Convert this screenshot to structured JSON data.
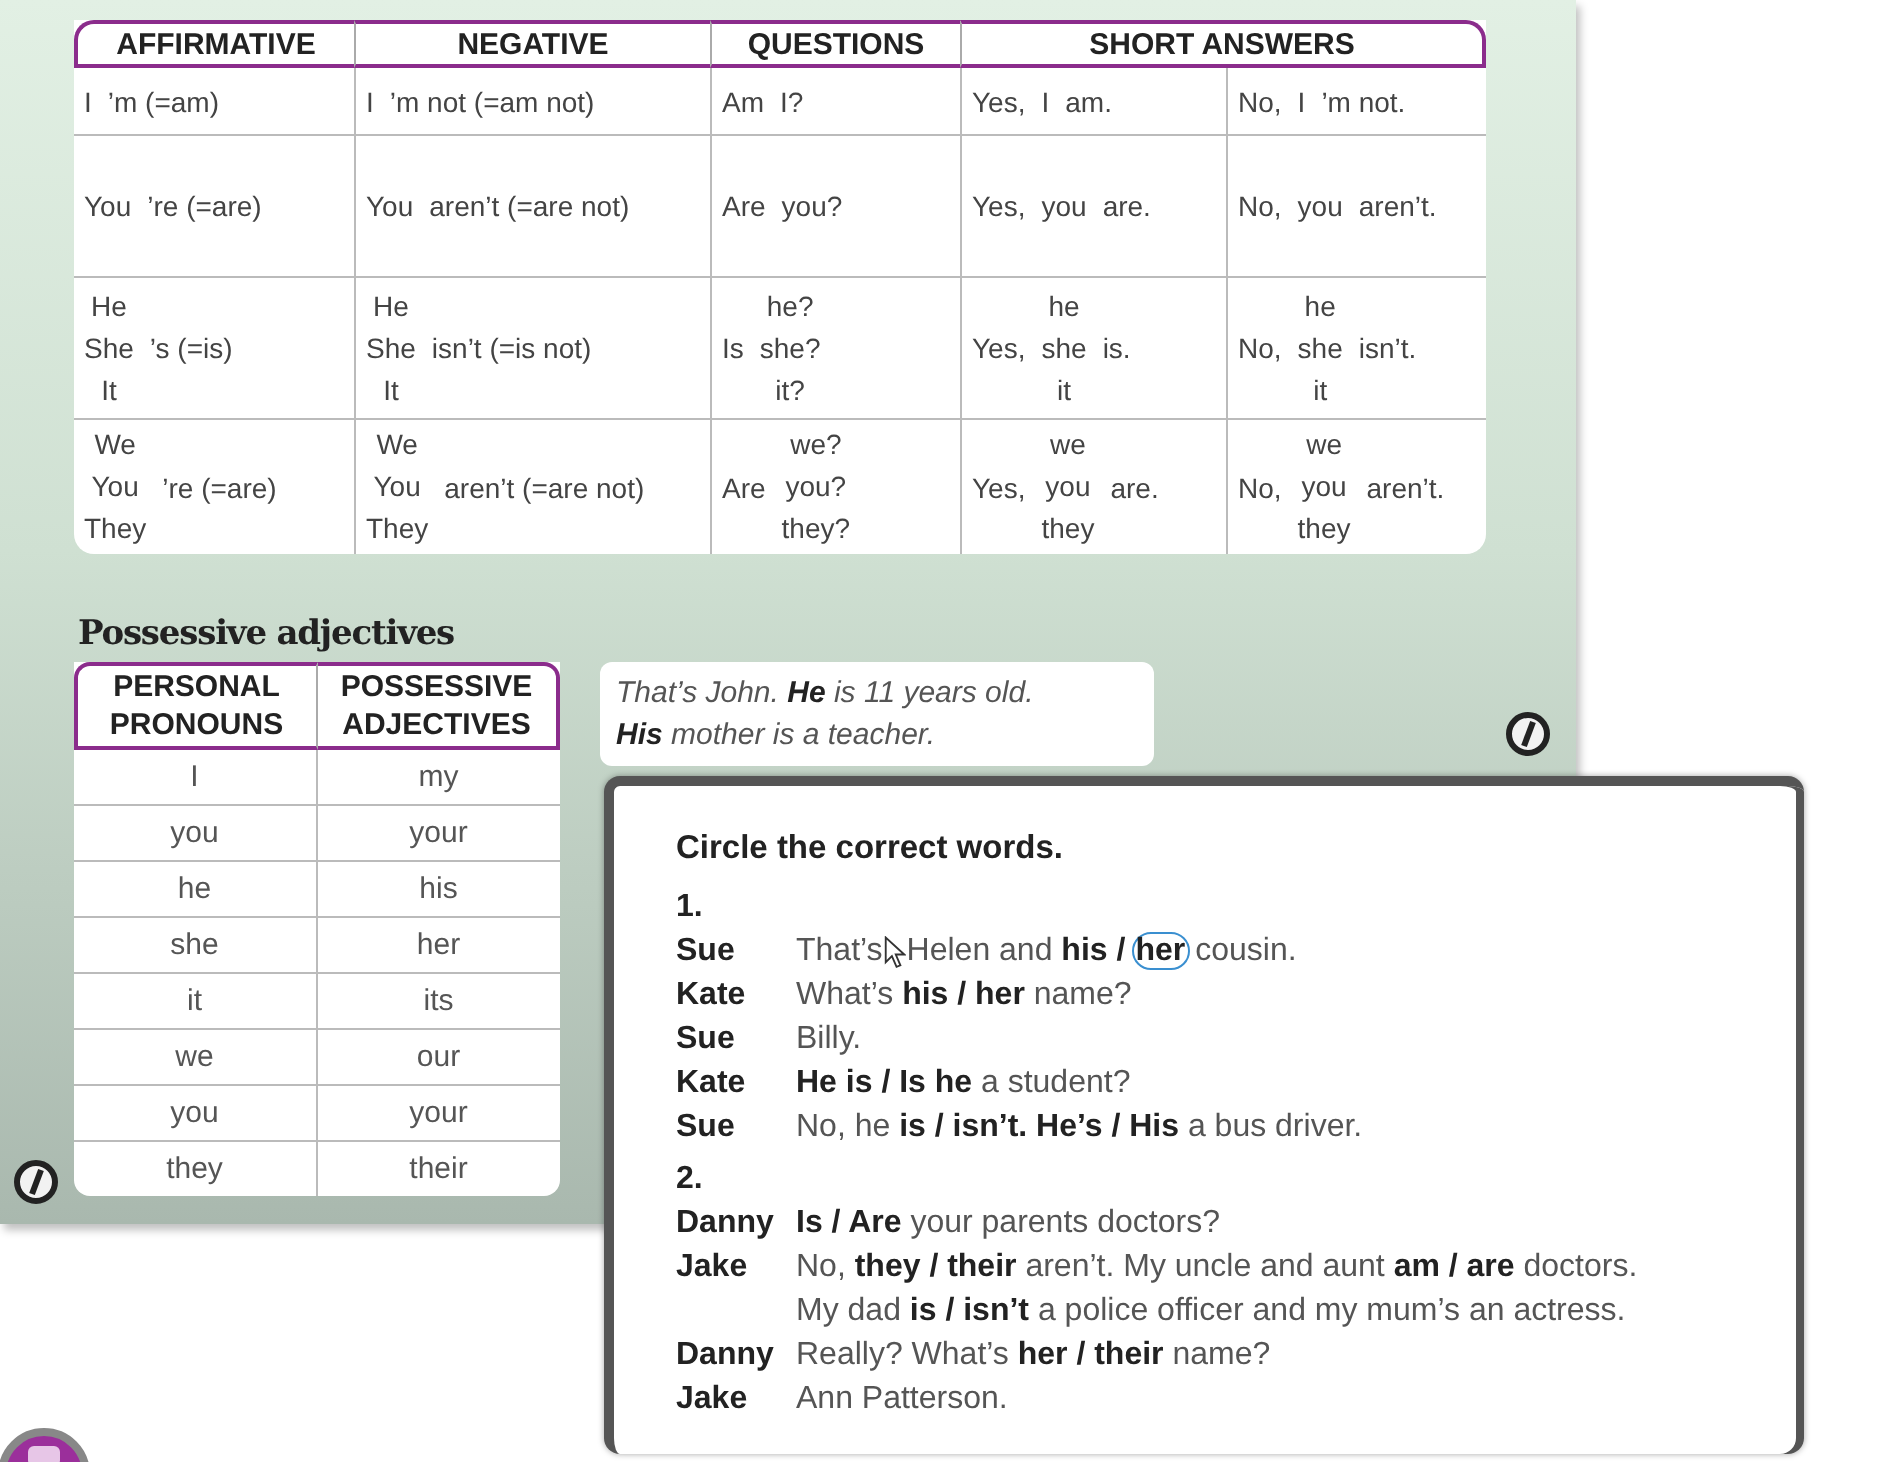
{
  "verb_table": {
    "headers": [
      "AFFIRMATIVE",
      "NEGATIVE",
      "QUESTIONS",
      "SHORT ANSWERS"
    ],
    "rows": [
      [
        [
          "I",
          "’m (=am)"
        ],
        [
          "I",
          "’m not (=am not)"
        ],
        [
          "Am",
          "I?"
        ],
        [
          "Yes,",
          "I",
          "am."
        ],
        [
          "No,",
          "I",
          "’m not."
        ]
      ],
      [
        [
          "You",
          "’re (=are)"
        ],
        [
          "You",
          "aren’t (=are not)"
        ],
        [
          "Are",
          "you?"
        ],
        [
          "Yes,",
          "you",
          "are."
        ],
        [
          "No,",
          "you",
          "aren’t."
        ]
      ],
      [
        [
          [
            "He",
            "She",
            "It"
          ],
          "’s (=is)"
        ],
        [
          [
            "He",
            "She",
            "It"
          ],
          "isn’t (=is not)"
        ],
        [
          "Is",
          [
            "he?",
            "she?",
            "it?"
          ]
        ],
        [
          "Yes,",
          [
            "he",
            "she",
            "it"
          ],
          "is."
        ],
        [
          "No,",
          [
            "he",
            "she",
            "it"
          ],
          "isn’t."
        ]
      ],
      [
        [
          [
            "We",
            "You",
            "They"
          ],
          "’re (=are)"
        ],
        [
          [
            "We",
            "You",
            "They"
          ],
          "aren’t (=are not)"
        ],
        [
          "Are",
          [
            "we?",
            "you?",
            "they?"
          ]
        ],
        [
          "Yes,",
          [
            "we",
            "you",
            "they"
          ],
          "are."
        ],
        [
          "No,",
          [
            "we",
            "you",
            "they"
          ],
          "aren’t."
        ]
      ]
    ]
  },
  "possessive": {
    "title": "Possessive adjectives",
    "headers": [
      "PERSONAL PRONOUNS",
      "POSSESSIVE ADJECTIVES"
    ],
    "rows": [
      [
        "I",
        "my"
      ],
      [
        "you",
        "your"
      ],
      [
        "he",
        "his"
      ],
      [
        "she",
        "her"
      ],
      [
        "it",
        "its"
      ],
      [
        "we",
        "our"
      ],
      [
        "you",
        "your"
      ],
      [
        "they",
        "their"
      ]
    ]
  },
  "example": {
    "lines": [
      "That’s John. **He** is 11 years old.",
      "**His** mother is a teacher."
    ]
  },
  "exercise": {
    "instruction": "Circle the correct words.",
    "items": [
      {
        "number": "1.",
        "lines": [
          {
            "speaker": "Sue",
            "segments": [
              {
                "text": "That’s",
                "circled": false
              },
              {
                "text": "Helen and **his /**",
                "circled": false
              },
              {
                "text": "**her**",
                "circled": true
              },
              {
                "text": "cousin.",
                "circled": false
              }
            ]
          },
          {
            "speaker": "Kate",
            "segments": [
              {
                "text": "What’s **his / her** name?",
                "circled": false
              }
            ]
          },
          {
            "speaker": "Sue",
            "segments": [
              {
                "text": "Billy.",
                "circled": false
              }
            ]
          },
          {
            "speaker": "Kate",
            "segments": [
              {
                "text": "**He is / Is he** a student?",
                "circled": false
              }
            ]
          },
          {
            "speaker": "Sue",
            "segments": [
              {
                "text": "No, he **is / isn’t. He’s / His** a bus driver.",
                "circled": false
              }
            ]
          }
        ]
      },
      {
        "number": "2.",
        "lines": [
          {
            "speaker": "Danny",
            "segments": [
              {
                "text": "**Is / Are** your parents doctors?",
                "circled": false
              }
            ]
          },
          {
            "speaker": "Jake",
            "segments": [
              {
                "text": "No, **they / their** aren’t. My uncle and aunt **am / are** doctors.",
                "circled": false
              }
            ]
          },
          {
            "segments": [
              {
                "text": "My dad **is / isn’t** a police officer and my mum’s an actress.",
                "circled": false
              }
            ]
          },
          {
            "speaker": "Danny",
            "segments": [
              {
                "text": "Really? What’s **her / their** name?",
                "circled": false
              }
            ]
          },
          {
            "speaker": "Jake",
            "segments": [
              {
                "text": "Ann Patterson.",
                "circled": false
              }
            ]
          }
        ]
      }
    ]
  }
}
